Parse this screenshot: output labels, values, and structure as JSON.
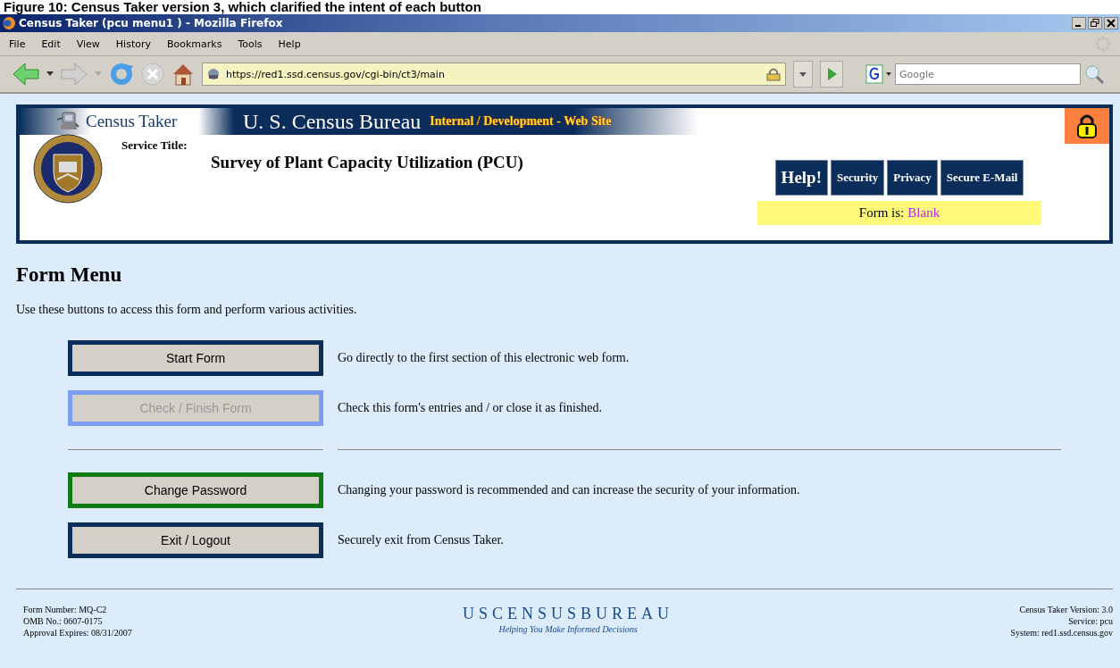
{
  "caption": "Figure 10: Census Taker version 3, which clarified the intent of each button",
  "window": {
    "title": "Census Taker (pcu menu1 ) - Mozilla Firefox"
  },
  "menu": [
    "File",
    "Edit",
    "View",
    "History",
    "Bookmarks",
    "Tools",
    "Help"
  ],
  "toolbar": {
    "url": "https://red1.ssd.census.gov/cgi-bin/ct3/main",
    "search_placeholder": "Google"
  },
  "banner": {
    "app_name": "Census Taker",
    "agency": "U. S. Census Bureau",
    "site_note": "Internal / Development - Web Site"
  },
  "service": {
    "label": "Service Title:",
    "title": "Survey of Plant Capacity Utilization (PCU)"
  },
  "links": [
    {
      "label": "Help!",
      "kind": "large"
    },
    {
      "label": "Security",
      "kind": "small"
    },
    {
      "label": "Privacy",
      "kind": "small"
    },
    {
      "label": "Secure E-Mail",
      "kind": "small"
    }
  ],
  "form_status": {
    "label": "Form is:",
    "value": "Blank"
  },
  "heading": "Form Menu",
  "intro": "Use these buttons to access this form and perform various activities.",
  "actions": [
    {
      "kind": "button",
      "label": "Start Form",
      "description": "Go directly to the first section of this electronic web form.",
      "color": "#0a2d5a",
      "disabled": false
    },
    {
      "kind": "button",
      "label": "Check / Finish Form",
      "description": "Check this form's entries and / or close it as finished.",
      "color": "#7a9df0",
      "disabled": true
    },
    {
      "kind": "divider"
    },
    {
      "kind": "button",
      "label": "Change Password",
      "description": "Changing your password is recommended and can increase the security of your information.",
      "color": "#0e7a14",
      "disabled": false
    },
    {
      "kind": "button",
      "label": "Exit / Logout",
      "description": "Securely exit from Census Taker.",
      "color": "#0a2d5a",
      "disabled": false
    }
  ],
  "footer": {
    "left": [
      "Form Number: MQ-C2",
      "OMB No.: 0607-0175",
      "Approval Expires: 08/31/2007"
    ],
    "logo": "USCENSUSBUREAU",
    "tagline": "Helping You Make Informed Decisions",
    "right": [
      "Census Taker Version: 3.0",
      "Service: pcu",
      "System: red1.ssd.census.gov"
    ]
  }
}
